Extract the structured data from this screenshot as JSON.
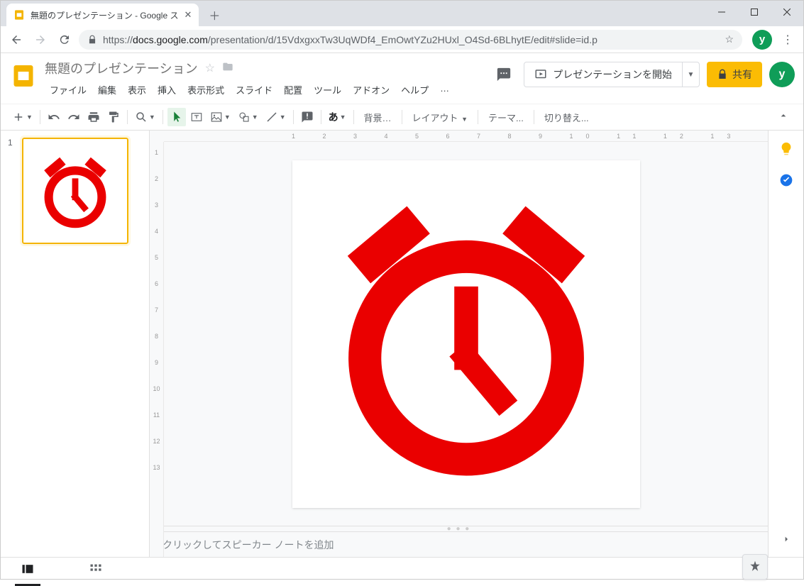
{
  "window": {
    "tab_title": "無題のプレゼンテーション - Google ス"
  },
  "browser": {
    "url_prefix": "https://",
    "url_host": "docs.google.com",
    "url_path": "/presentation/d/15VdxgxxTw3UqWDf4_EmOwtYZu2HUxl_O4Sd-6BLhytE/edit#slide=id.p"
  },
  "doc": {
    "title": "無題のプレゼンテーション"
  },
  "menu": {
    "file": "ファイル",
    "edit": "編集",
    "view": "表示",
    "insert": "挿入",
    "format": "表示形式",
    "slide": "スライド",
    "arrange": "配置",
    "tools": "ツール",
    "addons": "アドオン",
    "help": "ヘルプ",
    "more": "…"
  },
  "header": {
    "present": "プレゼンテーションを開始",
    "share": "共有",
    "avatar_letter": "y"
  },
  "toolbar": {
    "background": "背景…",
    "layout": "レイアウト",
    "theme": "テーマ...",
    "transition": "切り替え..."
  },
  "filmstrip": {
    "slide1_num": "1"
  },
  "ruler_h_marks": "1 2 3 4 5 6 7 8 9 10 11 12 13",
  "ruler_v_marks": [
    "1",
    "2",
    "3",
    "4",
    "5",
    "6",
    "7",
    "8",
    "9",
    "10",
    "11",
    "12",
    "13"
  ],
  "notes": {
    "placeholder": "クリックしてスピーカー ノートを追加"
  },
  "colors": {
    "accent_icon": "#ea0000",
    "share_button": "#fbbc04",
    "avatar": "#0f9d58"
  }
}
